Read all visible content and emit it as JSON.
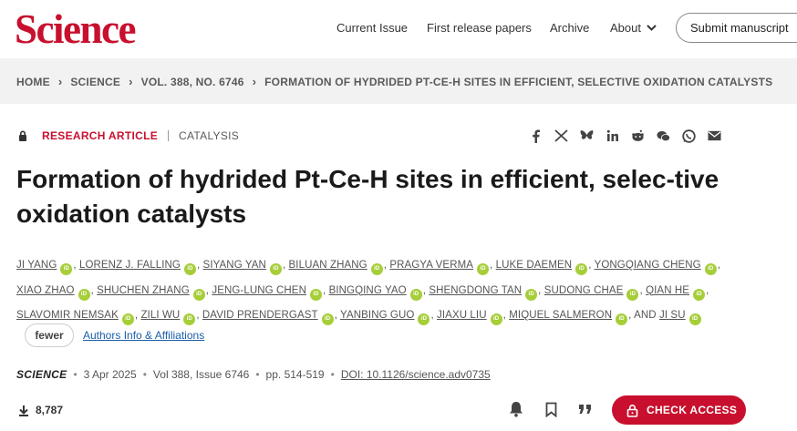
{
  "header": {
    "logo": "Science",
    "nav": {
      "current_issue": "Current Issue",
      "first_release": "First release papers",
      "archive": "Archive",
      "about": "About",
      "submit": "Submit manuscript"
    }
  },
  "breadcrumb": {
    "items": [
      "HOME",
      "SCIENCE",
      "VOL. 388, NO. 6746",
      "FORMATION OF HYDRIDED PT-CE-H SITES IN EFFICIENT, SELECTIVE OXIDATION CATALYSTS"
    ]
  },
  "article": {
    "type": "RESEARCH ARTICLE",
    "category": "CATALYSIS",
    "title": "Formation of hydrided Pt-Ce-H sites in efficient, selec-tive oxidation catalysts",
    "authors": [
      "JI YANG",
      "LORENZ J. FALLING",
      "SIYANG YAN",
      "BILUAN ZHANG",
      "PRAGYA VERMA",
      "LUKE DAEMEN",
      "YONGQIANG CHENG",
      "XIAO ZHAO",
      "SHUCHEN ZHANG",
      "JENG-LUNG CHEN",
      "BINGQING YAO",
      "SHENGDONG TAN",
      "SUDONG CHAE",
      "QIAN HE",
      "SLAVOMIR NEMSAK",
      "ZILI WU",
      "DAVID PRENDERGAST",
      "YANBING GUO",
      "JIAXU LIU",
      "MIQUEL SALMERON",
      "JI SU"
    ],
    "and_label": "AND",
    "orcid_label": "iD",
    "fewer_label": "fewer",
    "affiliations_label": "Authors Info & Affiliations"
  },
  "citation": {
    "journal": "SCIENCE",
    "date": "3 Apr 2025",
    "volume": "Vol 388, Issue 6746",
    "pages": "pp. 514-519",
    "doi": "DOI: 10.1126/science.adv0735"
  },
  "metrics": {
    "downloads": "8,787"
  },
  "actions": {
    "check_access": "CHECK ACCESS"
  },
  "colors": {
    "brand_red": "#c8102e",
    "orcid_green": "#a6ce39",
    "link_blue": "#1a5ea8"
  }
}
